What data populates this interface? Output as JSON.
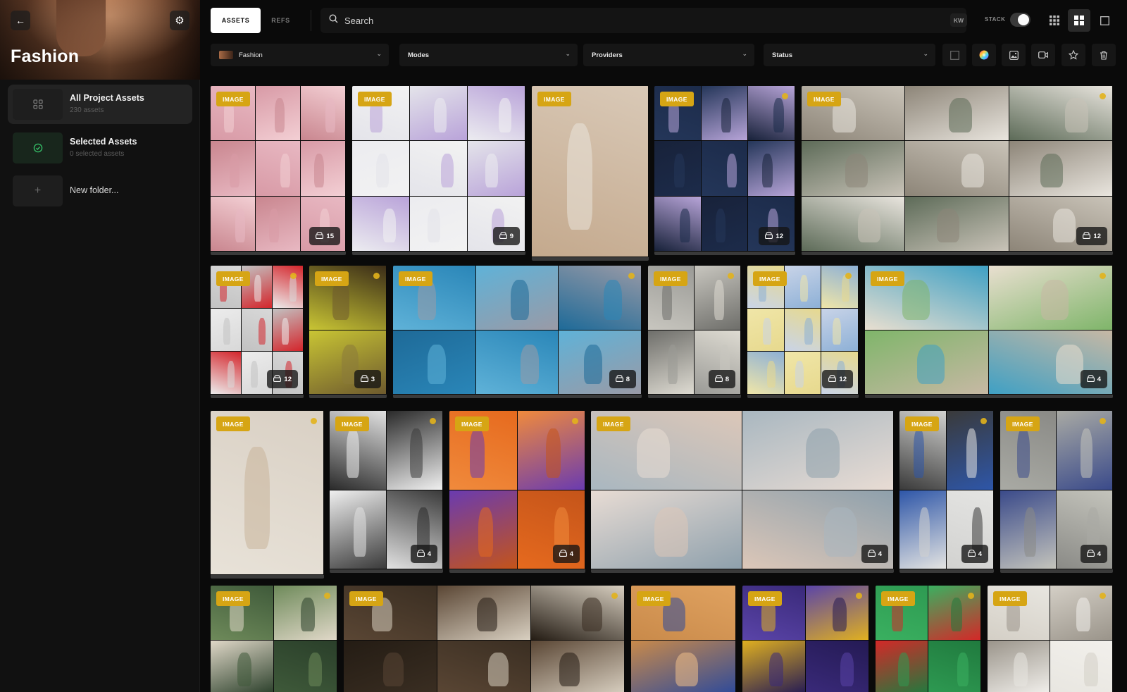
{
  "sidebar": {
    "back_icon": "arrow-left-icon",
    "settings_icon": "gear-icon",
    "project_title": "Fashion",
    "items": [
      {
        "title": "All Project Assets",
        "subtitle": "230 assets",
        "icon": "grid-icon"
      },
      {
        "title": "Selected Assets",
        "subtitle": "0 selected assets",
        "icon": "check-circle-icon"
      },
      {
        "title": "New folder...",
        "icon": "plus-icon"
      }
    ]
  },
  "toolbar": {
    "tabs": [
      {
        "label": "ASSETS"
      },
      {
        "label": "REFS"
      }
    ],
    "search": {
      "placeholder": "Search",
      "icon": "search-icon"
    },
    "kw_label": "KW",
    "stack_label": "STACK",
    "stack_on": true,
    "views": [
      "small-grid-icon",
      "large-grid-icon",
      "single-view-icon"
    ]
  },
  "filters": {
    "project": "Fashion",
    "modes": "Modes",
    "providers": "Providers",
    "status": "Status",
    "tools": [
      "select-all-icon",
      "color-wheel-icon",
      "image-filter-icon",
      "video-filter-icon",
      "star-icon",
      "trash-icon"
    ]
  },
  "badge_label": "IMAGE",
  "assets": [
    {
      "count": "15",
      "palette": [
        "#e8b8c2",
        "#d89aa6",
        "#f3cfd4",
        "#c9868f"
      ],
      "dot": false
    },
    {
      "count": "9",
      "palette": [
        "#f2f2f2",
        "#e4e4ea",
        "#b9a3d9",
        "#ececf0"
      ],
      "dot": false
    },
    {
      "count": null,
      "palette": [
        "#d9c9b7",
        "#c4a98d",
        "#eae3da",
        "#a8825f"
      ],
      "dot": false
    },
    {
      "count": "12",
      "palette": [
        "#1c2b4a",
        "#243659",
        "#b7a4d8",
        "#18223a"
      ],
      "dot": true
    },
    {
      "count": "12",
      "palette": [
        "#c9c3b8",
        "#8d8578",
        "#e9e5de",
        "#5d6b58"
      ],
      "dot": true
    },
    {
      "count": "12",
      "palette": [
        "#d8d8d8",
        "#c2c2c2",
        "#d4252b",
        "#ececec"
      ],
      "dot": true
    },
    {
      "count": "3",
      "palette": [
        "#3a2c18",
        "#c9c534",
        "#6e5a2e",
        "#8a7a3a"
      ],
      "dot": true
    },
    {
      "count": "8",
      "palette": [
        "#2a86b8",
        "#5fb2d8",
        "#9a9aa6",
        "#1e6a98"
      ],
      "dot": true
    },
    {
      "count": "8",
      "palette": [
        "#9a9a96",
        "#c8c6bf",
        "#6e6e6a",
        "#dedbd2"
      ],
      "dot": true
    },
    {
      "count": "12",
      "palette": [
        "#e7d98e",
        "#c9d4e8",
        "#8db0d6",
        "#f0e6a8"
      ],
      "dot": true
    },
    {
      "count": "4",
      "palette": [
        "#3fa0c4",
        "#e9dfd0",
        "#7fb56a",
        "#c7b8a4"
      ],
      "dot": true
    },
    {
      "count": null,
      "palette": [
        "#d9d0c4",
        "#e8e2d8",
        "#c8b49a",
        "#f0ebe4"
      ],
      "dot": true
    },
    {
      "count": "4",
      "palette": [
        "#e2e2e2",
        "#2a2a2a",
        "#f0f0f0",
        "#3a3a3a"
      ],
      "dot": true
    },
    {
      "count": "4",
      "palette": [
        "#e66a1e",
        "#f08a3c",
        "#6a3bb0",
        "#c4541a"
      ],
      "dot": true
    },
    {
      "count": "4",
      "palette": [
        "#dcc7b8",
        "#a9b7c0",
        "#e8dcd4",
        "#8ea0ac"
      ],
      "dot": false
    },
    {
      "count": "4",
      "palette": [
        "#d2d2d0",
        "#3a3a3a",
        "#2e56a8",
        "#e4e4e2"
      ],
      "dot": true
    },
    {
      "count": "4",
      "palette": [
        "#8a8a86",
        "#a9aaa4",
        "#3a4a8a",
        "#c4c4bc"
      ],
      "dot": true
    },
    {
      "count": null,
      "palette": [
        "#3f5a3a",
        "#6e8a5a",
        "#e0d8c8",
        "#2a3f2a"
      ],
      "dot": true
    },
    {
      "count": null,
      "palette": [
        "#3a2e22",
        "#5a4634",
        "#d8cfc0",
        "#241c14"
      ],
      "dot": true
    },
    {
      "count": null,
      "palette": [
        "#e0a260",
        "#c98a4a",
        "#2e4a9a",
        "#f0c088"
      ],
      "dot": false
    },
    {
      "count": null,
      "palette": [
        "#3a2a7a",
        "#5a44a8",
        "#e0b020",
        "#241a54"
      ],
      "dot": true
    },
    {
      "count": null,
      "palette": [
        "#2e9a52",
        "#3ab060",
        "#d42828",
        "#207a3e"
      ],
      "dot": true
    },
    {
      "count": null,
      "palette": [
        "#e8e6e0",
        "#d4cfc6",
        "#9a948a",
        "#f2f0ec"
      ],
      "dot": true
    }
  ]
}
